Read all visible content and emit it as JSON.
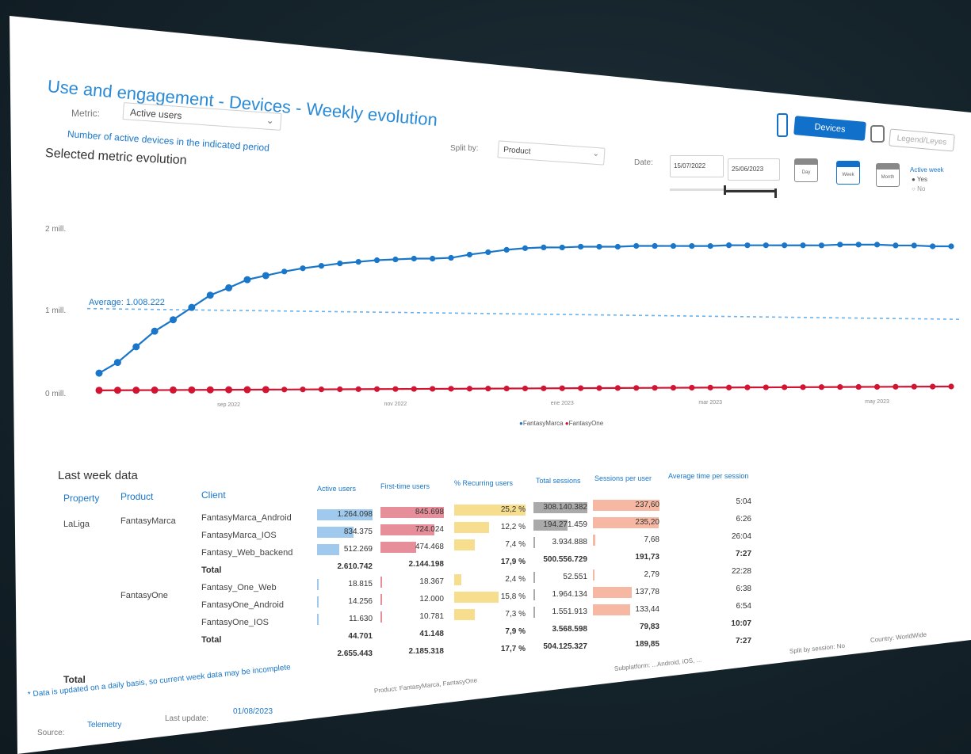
{
  "header": {
    "title": "Use and engagement - Devices - Weekly evolution",
    "metric_label": "Metric:",
    "metric_value": "Active users",
    "metric_desc": "Number of active devices in the indicated period",
    "split_label": "Split by:",
    "split_value": "Product",
    "date_label": "Date:",
    "date_from": "15/07/2022",
    "date_to": "25/06/2023",
    "devices_button": "Devices",
    "legend_button": "Legend/Leyes",
    "cal_day": "Day",
    "cal_week": "Week",
    "cal_month": "Month",
    "active_label": "Active week",
    "radio_yes": "Yes",
    "radio_no": "No"
  },
  "chart_section_title": "Selected metric evolution",
  "chart_data": {
    "type": "line",
    "ylabel": "",
    "xlabel": "",
    "yticks": [
      "0 mill.",
      "1 mill.",
      "2 mill."
    ],
    "ylim": [
      0,
      2200000
    ],
    "xticks": [
      "sep 2022",
      "nov 2022",
      "ene 2023",
      "mar 2023",
      "may 2023"
    ],
    "xtick_index": [
      7,
      16,
      25,
      33,
      42
    ],
    "average_label": "Average: 1.008.222",
    "average_value": 1008222,
    "series": [
      {
        "name": "FantasyMarca",
        "color": "#1976c9",
        "values": [
          250000,
          380000,
          570000,
          760000,
          900000,
          1050000,
          1200000,
          1290000,
          1390000,
          1440000,
          1490000,
          1530000,
          1560000,
          1590000,
          1610000,
          1630000,
          1640000,
          1650000,
          1650000,
          1660000,
          1700000,
          1730000,
          1760000,
          1780000,
          1790000,
          1790000,
          1800000,
          1800000,
          1800000,
          1810000,
          1810000,
          1810000,
          1810000,
          1810000,
          1820000,
          1820000,
          1820000,
          1820000,
          1820000,
          1820000,
          1830000,
          1830000,
          1830000,
          1820000,
          1820000,
          1810000,
          1810000
        ]
      },
      {
        "name": "FantasyOne",
        "color": "#d11432",
        "values": [
          40000,
          40000,
          40000,
          40000,
          40000,
          40000,
          40000,
          40000,
          40000,
          40000,
          40000,
          40000,
          40000,
          40000,
          40000,
          40000,
          40000,
          40000,
          40000,
          40000,
          40000,
          40000,
          40000,
          40000,
          40000,
          40000,
          40000,
          40000,
          40000,
          40000,
          40000,
          40000,
          40000,
          40000,
          40000,
          40000,
          40000,
          40000,
          40000,
          40000,
          40000,
          40000,
          40000,
          40000,
          40000,
          40000,
          40000
        ]
      }
    ]
  },
  "legend": {
    "fm": "FantasyMarca",
    "fo": "FantasyOne"
  },
  "table": {
    "title": "Last week data",
    "col_property": "Property",
    "col_product": "Product",
    "col_client": "Client",
    "col_active": "Active users",
    "col_first": "First-time users",
    "col_recurring": "% Recurring users",
    "col_sessions": "Total sessions",
    "col_spu": "Sessions per user",
    "col_avgtime": "Average time per session",
    "property": "LaLiga",
    "product1": "FantasyMarca",
    "product2": "FantasyOne",
    "grand_total_label": "Total",
    "rows": [
      {
        "client": "FantasyMarca_Android",
        "active": "1.264.098",
        "first": "845.698",
        "rec": "25,2 %",
        "sess": "308.140.382",
        "spu": "237,60",
        "avg": "5:04"
      },
      {
        "client": "FantasyMarca_IOS",
        "active": "834.375",
        "first": "724.024",
        "rec": "12,2 %",
        "sess": "194.271.459",
        "spu": "235,20",
        "avg": "6:26"
      },
      {
        "client": "Fantasy_Web_backend",
        "active": "512.269",
        "first": "474.468",
        "rec": "7,4 %",
        "sess": "3.934.888",
        "spu": "7,68",
        "avg": "26:04"
      },
      {
        "client": "Total",
        "active": "2.610.742",
        "first": "2.144.198",
        "rec": "17,9 %",
        "sess": "500.556.729",
        "spu": "191,73",
        "avg": "7:27",
        "total": true
      },
      {
        "client": "Fantasy_One_Web",
        "active": "18.815",
        "first": "18.367",
        "rec": "2,4 %",
        "sess": "52.551",
        "spu": "2,79",
        "avg": "22:28"
      },
      {
        "client": "FantasyOne_Android",
        "active": "14.256",
        "first": "12.000",
        "rec": "15,8 %",
        "sess": "1.964.134",
        "spu": "137,78",
        "avg": "6:38"
      },
      {
        "client": "FantasyOne_IOS",
        "active": "11.630",
        "first": "10.781",
        "rec": "7,3 %",
        "sess": "1.551.913",
        "spu": "133,44",
        "avg": "6:54"
      },
      {
        "client": "Total",
        "active": "44.701",
        "first": "41.148",
        "rec": "7,9 %",
        "sess": "3.568.598",
        "spu": "79,83",
        "avg": "10:07",
        "total": true
      },
      {
        "client": "",
        "active": "2.655.443",
        "first": "2.185.318",
        "rec": "17,7 %",
        "sess": "504.125.327",
        "spu": "189,85",
        "avg": "7:27",
        "total": true
      }
    ]
  },
  "footer": {
    "note": "* Data is updated on a daily basis, so current week data may be incomplete",
    "source_label": "Source:",
    "source_value": "Telemetry",
    "update_label": "Last update:",
    "update_value": "01/08/2023",
    "product_filter": "Product:  FantasyMarca, FantasyOne",
    "subplatform": "Subplatform:  ...Android, iOS, ...",
    "split_sessions": "Split by session:  No",
    "country": "Country:  WorldWide"
  },
  "colors": {
    "accent": "#1976c9",
    "series_blue": "#1976c9",
    "series_red": "#d11432",
    "bar_blue": "#8ec1ea",
    "bar_red": "#e27b8a",
    "bar_yellow": "#f5d87a",
    "bar_gray": "#9b9b9b",
    "bar_salmon": "#f4ab93"
  }
}
